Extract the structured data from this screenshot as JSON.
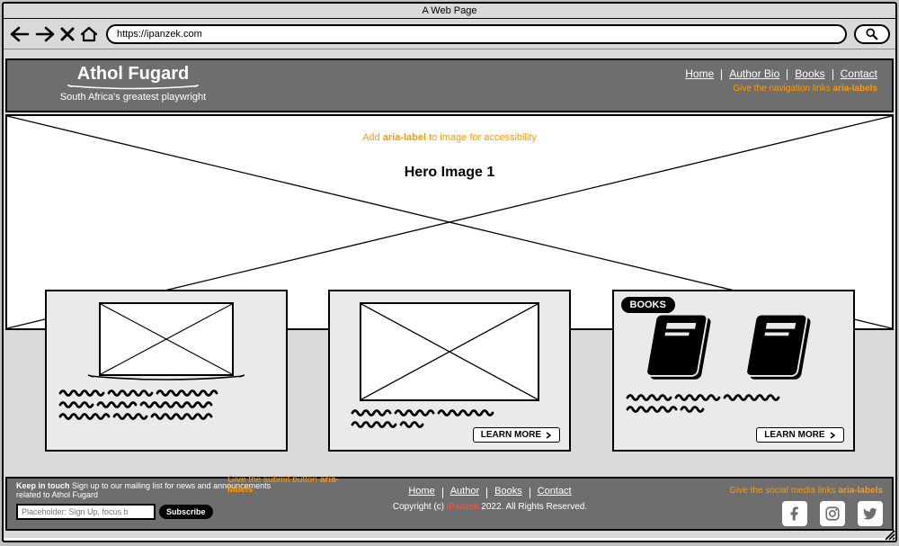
{
  "browser": {
    "title": "A Web Page",
    "url": "https://ipanzek.com"
  },
  "header": {
    "brand_title": "Athol Fugard",
    "brand_tagline": "South Africa's greatest playwright",
    "nav": [
      "Home",
      "Author Bio",
      "Books",
      "Contact"
    ],
    "nav_annotation": "Give the navigation links ",
    "nav_annotation_bold": "aria-labels"
  },
  "hero": {
    "annotation_pre": "Add ",
    "annotation_bold": "aria-label",
    "annotation_post": " to image for accessibility",
    "title": "Hero Image 1"
  },
  "cards": {
    "learn_more_label": "LEARN MORE",
    "books_label": "BOOKS"
  },
  "footer": {
    "keep_in_touch_bold": "Keep in touch",
    "keep_in_touch_text": " Sign up to our mailing list for news and announcements related to Athol Fugard",
    "signup_placeholder": "Placeholder: Sign Up, focus b",
    "subscribe_label": "Subscribe",
    "submit_annotation": "Give the submit button ",
    "submit_annotation_bold": "aria-labels",
    "nav": [
      "Home",
      "Author",
      "Books",
      "Contact"
    ],
    "copyright_pre": "Copyright (c) ",
    "copyright_brand": "iPanzek",
    "copyright_post": " 2022. All Rights Reserved.",
    "social_annotation": "Give the social media links ",
    "social_annotation_bold": "aria-labels"
  }
}
